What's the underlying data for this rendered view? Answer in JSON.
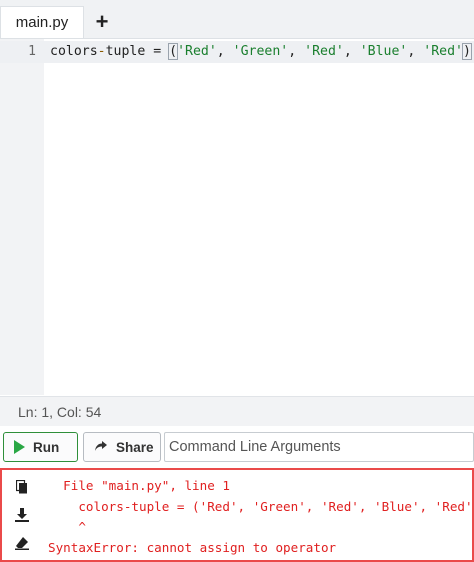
{
  "tabs": [
    {
      "label": "main.py"
    }
  ],
  "tab_add_label": "+",
  "editor": {
    "line_number": "1",
    "code_parts": [
      "colors",
      "-",
      "tuple = ",
      "(",
      "'Red'",
      ", ",
      "'Green'",
      ", ",
      "'Red'",
      ", ",
      "'Blue'",
      ", ",
      "'Red'",
      ")"
    ]
  },
  "status": {
    "text": "Ln: 1,  Col: 54"
  },
  "toolbar": {
    "run_label": "Run",
    "share_label": "Share",
    "cmd_placeholder": "Command Line Arguments"
  },
  "console": {
    "icons": [
      "copy-icon",
      "download-icon",
      "eraser-icon"
    ],
    "lines": [
      "  File \"main.py\", line 1",
      "    colors-tuple = ('Red', 'Green', 'Red', 'Blue', 'Red')",
      "    ^",
      "SyntaxError: cannot assign to operator"
    ]
  },
  "colors": {
    "error": "#e02020",
    "run_green": "#2aa745"
  }
}
